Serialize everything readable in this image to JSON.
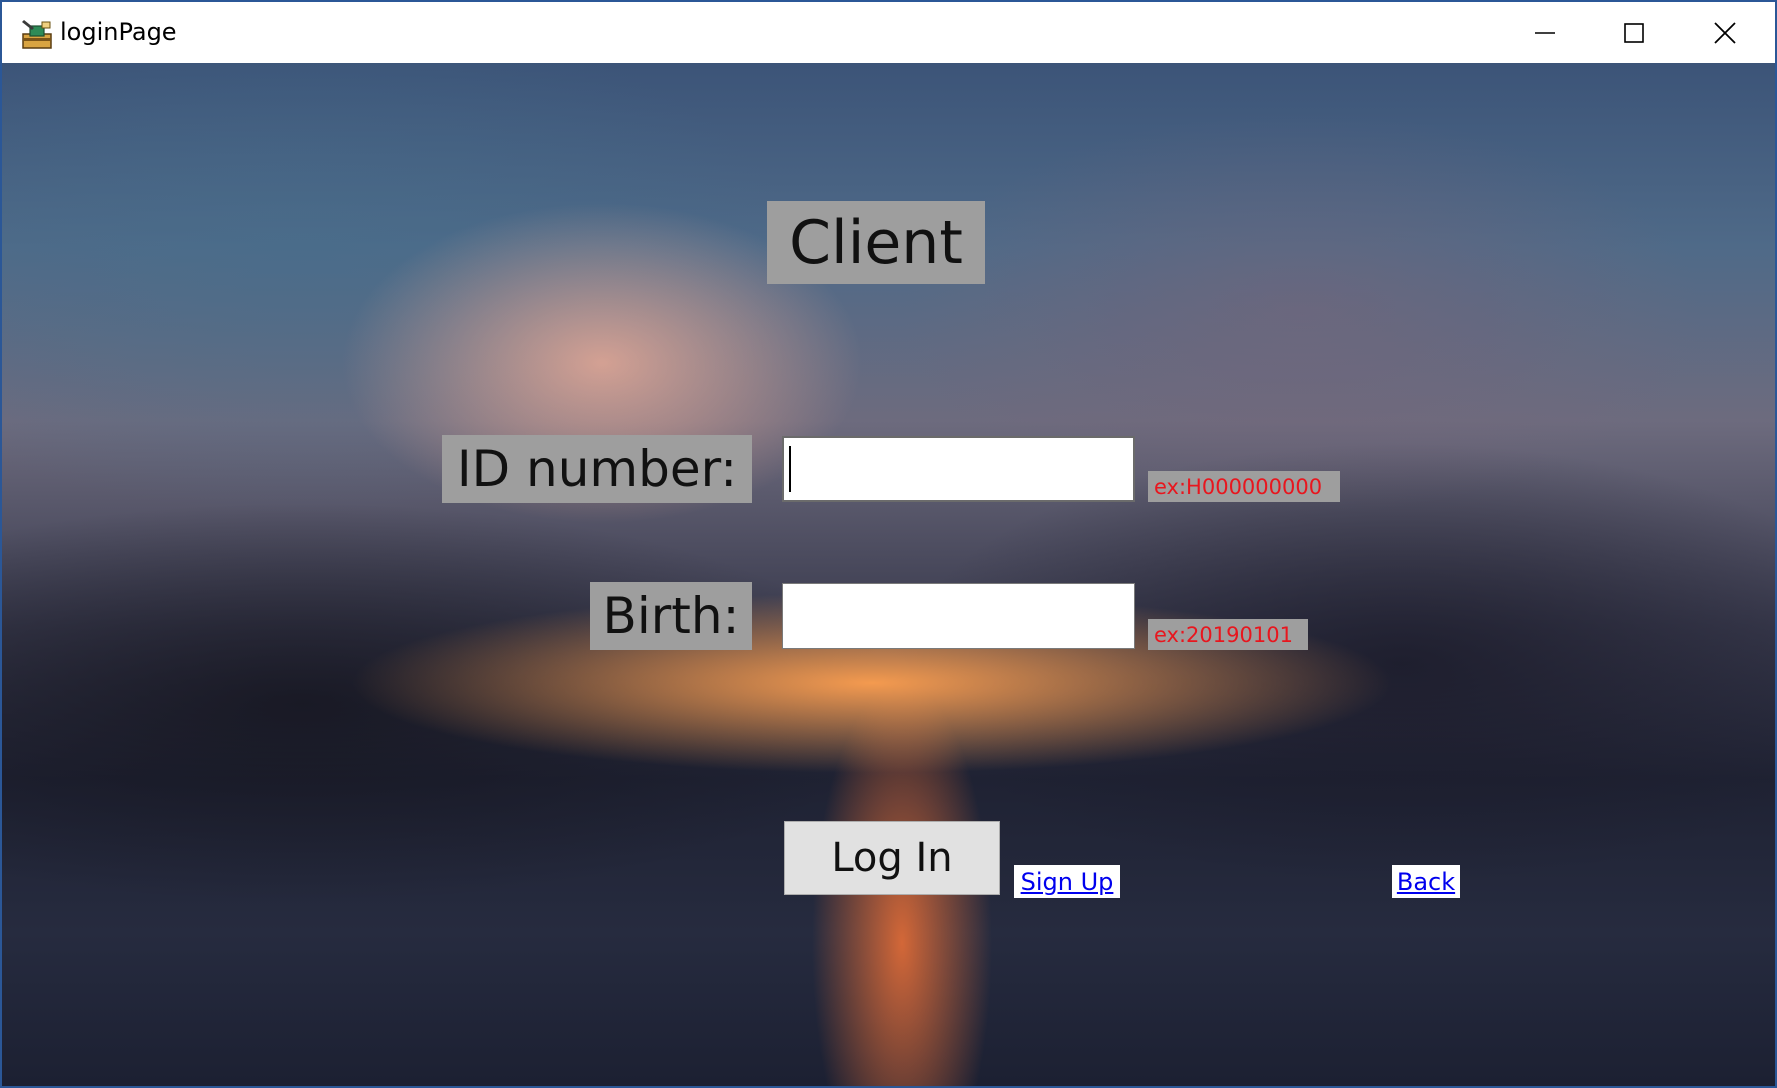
{
  "window": {
    "title": "loginPage",
    "controls": {
      "minimize_icon": "minimize-icon",
      "maximize_icon": "maximize-icon",
      "close_icon": "close-icon"
    },
    "border_color": "#2b5797"
  },
  "form": {
    "title": "Client",
    "id_label": "ID number:",
    "id_value": "",
    "id_hint": "ex:H000000000",
    "birth_label": "Birth:",
    "birth_value": "",
    "birth_hint": "ex:20190101",
    "login_label": "Log In",
    "signup_label": "Sign Up",
    "back_label": "Back"
  },
  "colors": {
    "label_bg": "#9e9e9e",
    "hint_text": "#e8161e",
    "link_text": "#0000ee",
    "button_bg": "#e1e1e1"
  }
}
